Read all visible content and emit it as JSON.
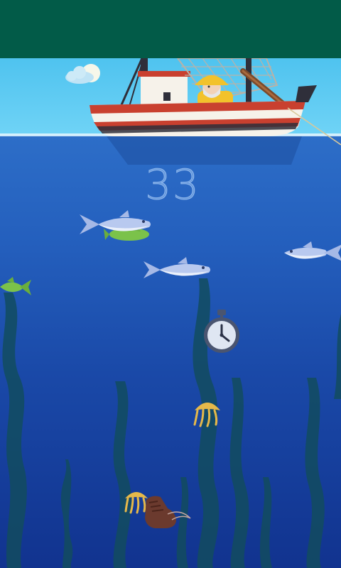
{
  "game": {
    "score": "33"
  },
  "colors": {
    "status_bar": "#025b48",
    "sky": "#5bc9f2",
    "water_top": "#2d6ec8",
    "water_bottom": "#11338f",
    "boat_hull_red": "#c9402f",
    "fisherman_hat": "#f2c22b"
  },
  "sprites": [
    "cloud-sun-icon",
    "fishing-boat",
    "fisherman",
    "fishing-net",
    "fishing-line",
    "fish-blue",
    "fish-green",
    "stopwatch-icon",
    "jellyfish-icon",
    "boot-junk",
    "seaweed"
  ]
}
